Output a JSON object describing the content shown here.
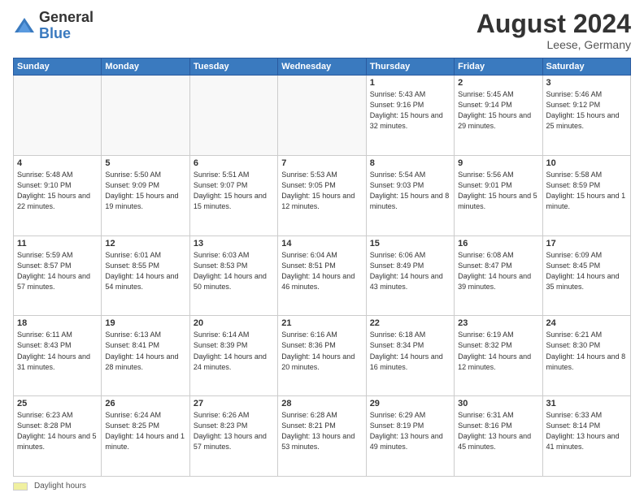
{
  "header": {
    "logo_general": "General",
    "logo_blue": "Blue",
    "month_year": "August 2024",
    "location": "Leese, Germany"
  },
  "footer": {
    "daylight_label": "Daylight hours"
  },
  "weekdays": [
    "Sunday",
    "Monday",
    "Tuesday",
    "Wednesday",
    "Thursday",
    "Friday",
    "Saturday"
  ],
  "weeks": [
    [
      {
        "day": "",
        "sunrise": "",
        "sunset": "",
        "daylight": ""
      },
      {
        "day": "",
        "sunrise": "",
        "sunset": "",
        "daylight": ""
      },
      {
        "day": "",
        "sunrise": "",
        "sunset": "",
        "daylight": ""
      },
      {
        "day": "",
        "sunrise": "",
        "sunset": "",
        "daylight": ""
      },
      {
        "day": "1",
        "sunrise": "Sunrise: 5:43 AM",
        "sunset": "Sunset: 9:16 PM",
        "daylight": "Daylight: 15 hours and 32 minutes."
      },
      {
        "day": "2",
        "sunrise": "Sunrise: 5:45 AM",
        "sunset": "Sunset: 9:14 PM",
        "daylight": "Daylight: 15 hours and 29 minutes."
      },
      {
        "day": "3",
        "sunrise": "Sunrise: 5:46 AM",
        "sunset": "Sunset: 9:12 PM",
        "daylight": "Daylight: 15 hours and 25 minutes."
      }
    ],
    [
      {
        "day": "4",
        "sunrise": "Sunrise: 5:48 AM",
        "sunset": "Sunset: 9:10 PM",
        "daylight": "Daylight: 15 hours and 22 minutes."
      },
      {
        "day": "5",
        "sunrise": "Sunrise: 5:50 AM",
        "sunset": "Sunset: 9:09 PM",
        "daylight": "Daylight: 15 hours and 19 minutes."
      },
      {
        "day": "6",
        "sunrise": "Sunrise: 5:51 AM",
        "sunset": "Sunset: 9:07 PM",
        "daylight": "Daylight: 15 hours and 15 minutes."
      },
      {
        "day": "7",
        "sunrise": "Sunrise: 5:53 AM",
        "sunset": "Sunset: 9:05 PM",
        "daylight": "Daylight: 15 hours and 12 minutes."
      },
      {
        "day": "8",
        "sunrise": "Sunrise: 5:54 AM",
        "sunset": "Sunset: 9:03 PM",
        "daylight": "Daylight: 15 hours and 8 minutes."
      },
      {
        "day": "9",
        "sunrise": "Sunrise: 5:56 AM",
        "sunset": "Sunset: 9:01 PM",
        "daylight": "Daylight: 15 hours and 5 minutes."
      },
      {
        "day": "10",
        "sunrise": "Sunrise: 5:58 AM",
        "sunset": "Sunset: 8:59 PM",
        "daylight": "Daylight: 15 hours and 1 minute."
      }
    ],
    [
      {
        "day": "11",
        "sunrise": "Sunrise: 5:59 AM",
        "sunset": "Sunset: 8:57 PM",
        "daylight": "Daylight: 14 hours and 57 minutes."
      },
      {
        "day": "12",
        "sunrise": "Sunrise: 6:01 AM",
        "sunset": "Sunset: 8:55 PM",
        "daylight": "Daylight: 14 hours and 54 minutes."
      },
      {
        "day": "13",
        "sunrise": "Sunrise: 6:03 AM",
        "sunset": "Sunset: 8:53 PM",
        "daylight": "Daylight: 14 hours and 50 minutes."
      },
      {
        "day": "14",
        "sunrise": "Sunrise: 6:04 AM",
        "sunset": "Sunset: 8:51 PM",
        "daylight": "Daylight: 14 hours and 46 minutes."
      },
      {
        "day": "15",
        "sunrise": "Sunrise: 6:06 AM",
        "sunset": "Sunset: 8:49 PM",
        "daylight": "Daylight: 14 hours and 43 minutes."
      },
      {
        "day": "16",
        "sunrise": "Sunrise: 6:08 AM",
        "sunset": "Sunset: 8:47 PM",
        "daylight": "Daylight: 14 hours and 39 minutes."
      },
      {
        "day": "17",
        "sunrise": "Sunrise: 6:09 AM",
        "sunset": "Sunset: 8:45 PM",
        "daylight": "Daylight: 14 hours and 35 minutes."
      }
    ],
    [
      {
        "day": "18",
        "sunrise": "Sunrise: 6:11 AM",
        "sunset": "Sunset: 8:43 PM",
        "daylight": "Daylight: 14 hours and 31 minutes."
      },
      {
        "day": "19",
        "sunrise": "Sunrise: 6:13 AM",
        "sunset": "Sunset: 8:41 PM",
        "daylight": "Daylight: 14 hours and 28 minutes."
      },
      {
        "day": "20",
        "sunrise": "Sunrise: 6:14 AM",
        "sunset": "Sunset: 8:39 PM",
        "daylight": "Daylight: 14 hours and 24 minutes."
      },
      {
        "day": "21",
        "sunrise": "Sunrise: 6:16 AM",
        "sunset": "Sunset: 8:36 PM",
        "daylight": "Daylight: 14 hours and 20 minutes."
      },
      {
        "day": "22",
        "sunrise": "Sunrise: 6:18 AM",
        "sunset": "Sunset: 8:34 PM",
        "daylight": "Daylight: 14 hours and 16 minutes."
      },
      {
        "day": "23",
        "sunrise": "Sunrise: 6:19 AM",
        "sunset": "Sunset: 8:32 PM",
        "daylight": "Daylight: 14 hours and 12 minutes."
      },
      {
        "day": "24",
        "sunrise": "Sunrise: 6:21 AM",
        "sunset": "Sunset: 8:30 PM",
        "daylight": "Daylight: 14 hours and 8 minutes."
      }
    ],
    [
      {
        "day": "25",
        "sunrise": "Sunrise: 6:23 AM",
        "sunset": "Sunset: 8:28 PM",
        "daylight": "Daylight: 14 hours and 5 minutes."
      },
      {
        "day": "26",
        "sunrise": "Sunrise: 6:24 AM",
        "sunset": "Sunset: 8:25 PM",
        "daylight": "Daylight: 14 hours and 1 minute."
      },
      {
        "day": "27",
        "sunrise": "Sunrise: 6:26 AM",
        "sunset": "Sunset: 8:23 PM",
        "daylight": "Daylight: 13 hours and 57 minutes."
      },
      {
        "day": "28",
        "sunrise": "Sunrise: 6:28 AM",
        "sunset": "Sunset: 8:21 PM",
        "daylight": "Daylight: 13 hours and 53 minutes."
      },
      {
        "day": "29",
        "sunrise": "Sunrise: 6:29 AM",
        "sunset": "Sunset: 8:19 PM",
        "daylight": "Daylight: 13 hours and 49 minutes."
      },
      {
        "day": "30",
        "sunrise": "Sunrise: 6:31 AM",
        "sunset": "Sunset: 8:16 PM",
        "daylight": "Daylight: 13 hours and 45 minutes."
      },
      {
        "day": "31",
        "sunrise": "Sunrise: 6:33 AM",
        "sunset": "Sunset: 8:14 PM",
        "daylight": "Daylight: 13 hours and 41 minutes."
      }
    ]
  ]
}
